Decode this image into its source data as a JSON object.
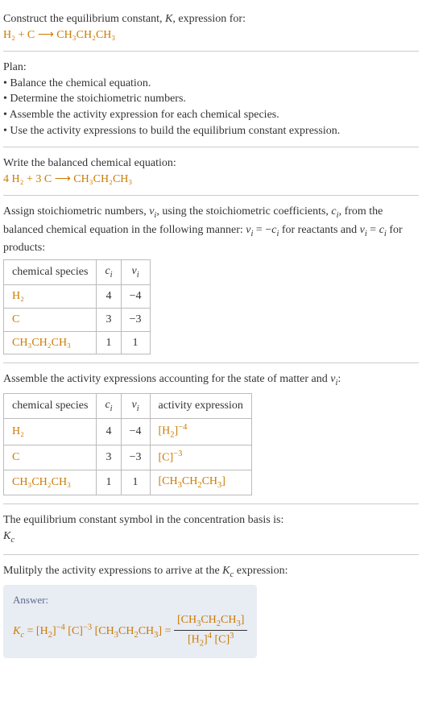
{
  "prompt": {
    "line1": "Construct the equilibrium constant, K, expression for:",
    "eqn": "H₂ + C ⟶ CH₃CH₂CH₃"
  },
  "plan": {
    "heading": "Plan:",
    "b1": "• Balance the chemical equation.",
    "b2": "• Determine the stoichiometric numbers.",
    "b3": "• Assemble the activity expression for each chemical species.",
    "b4": "• Use the activity expressions to build the equilibrium constant expression."
  },
  "balanced": {
    "heading": "Write the balanced chemical equation:",
    "eqn": "4 H₂ + 3 C ⟶ CH₃CH₂CH₃"
  },
  "assign": {
    "text1": "Assign stoichiometric numbers, νᵢ, using the stoichiometric coefficients, cᵢ, from the balanced chemical equation in the following manner: νᵢ = −cᵢ for reactants and νᵢ = cᵢ for products:",
    "headers": {
      "sp": "chemical species",
      "ci": "cᵢ",
      "vi": "νᵢ"
    },
    "rows": [
      {
        "sp": "H₂",
        "ci": "4",
        "vi": "−4"
      },
      {
        "sp": "C",
        "ci": "3",
        "vi": "−3"
      },
      {
        "sp": "CH₃CH₂CH₃",
        "ci": "1",
        "vi": "1"
      }
    ]
  },
  "assemble": {
    "text": "Assemble the activity expressions accounting for the state of matter and νᵢ:",
    "headers": {
      "sp": "chemical species",
      "ci": "cᵢ",
      "vi": "νᵢ",
      "ae": "activity expression"
    },
    "rows": [
      {
        "sp": "H₂",
        "ci": "4",
        "vi": "−4",
        "ae": "[H₂]⁻⁴"
      },
      {
        "sp": "C",
        "ci": "3",
        "vi": "−3",
        "ae": "[C]⁻³"
      },
      {
        "sp": "CH₃CH₂CH₃",
        "ci": "1",
        "vi": "1",
        "ae": "[CH₃CH₂CH₃]"
      }
    ]
  },
  "symbol": {
    "text": "The equilibrium constant symbol in the concentration basis is:",
    "kc": "K꜀"
  },
  "multiply": {
    "text": "Mulitply the activity expressions to arrive at the K꜀ expression:"
  },
  "answer": {
    "label": "Answer:",
    "lhs": "K꜀ = [H₂]⁻⁴ [C]⁻³ [CH₃CH₂CH₃] = ",
    "num": "[CH₃CH₂CH₃]",
    "den": "[H₂]⁴ [C]³"
  }
}
